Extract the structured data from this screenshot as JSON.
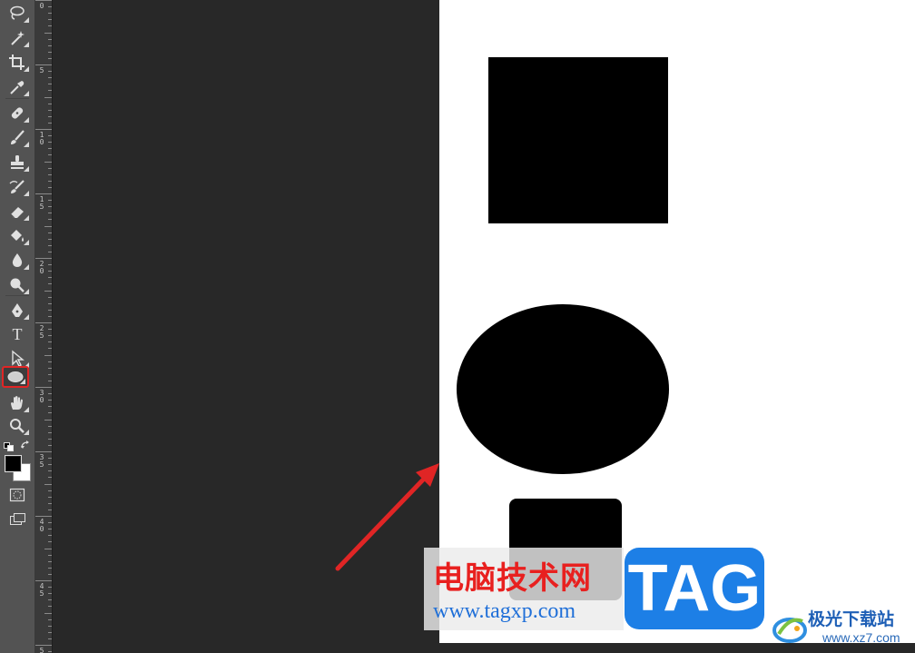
{
  "app": {
    "tools": [
      {
        "name": "lasso-icon",
        "label": "Lasso"
      },
      {
        "name": "magic-wand-icon",
        "label": "Magic Wand"
      },
      {
        "name": "crop-icon",
        "label": "Crop"
      },
      {
        "name": "eyedropper-icon",
        "label": "Eyedropper"
      },
      {
        "name": "healing-brush-icon",
        "label": "Healing Brush"
      },
      {
        "name": "brush-icon",
        "label": "Brush"
      },
      {
        "name": "clone-stamp-icon",
        "label": "Clone Stamp"
      },
      {
        "name": "history-brush-icon",
        "label": "History Brush"
      },
      {
        "name": "eraser-icon",
        "label": "Eraser"
      },
      {
        "name": "paint-bucket-icon",
        "label": "Paint Bucket"
      },
      {
        "name": "blur-icon",
        "label": "Blur"
      },
      {
        "name": "dodge-icon",
        "label": "Dodge"
      },
      {
        "name": "pen-icon",
        "label": "Pen"
      },
      {
        "name": "type-icon",
        "label": "T"
      },
      {
        "name": "path-selection-icon",
        "label": "Path Selection"
      },
      {
        "name": "ellipse-tool-icon",
        "label": "Ellipse",
        "active": true
      },
      {
        "name": "hand-icon",
        "label": "Hand"
      },
      {
        "name": "zoom-icon",
        "label": "Zoom"
      }
    ],
    "foreground_color": "#000000",
    "background_color": "#ffffff",
    "accent_highlight": "#e02525"
  },
  "ruler": {
    "labels": [
      {
        "text": "0"
      },
      {
        "text": "5"
      },
      {
        "text": "1\n0"
      },
      {
        "text": "1\n5"
      },
      {
        "text": "2\n0"
      },
      {
        "text": "2\n5"
      },
      {
        "text": "3\n0"
      },
      {
        "text": "3\n5"
      },
      {
        "text": "4\n0"
      },
      {
        "text": "4\n5"
      },
      {
        "text": "5"
      }
    ]
  },
  "watermark": {
    "cn_text": "电脑技术网",
    "url": "www.tagxp.com",
    "tag": "TAG",
    "site_title": "极光下载站",
    "site_url": "www.xz7.com"
  }
}
